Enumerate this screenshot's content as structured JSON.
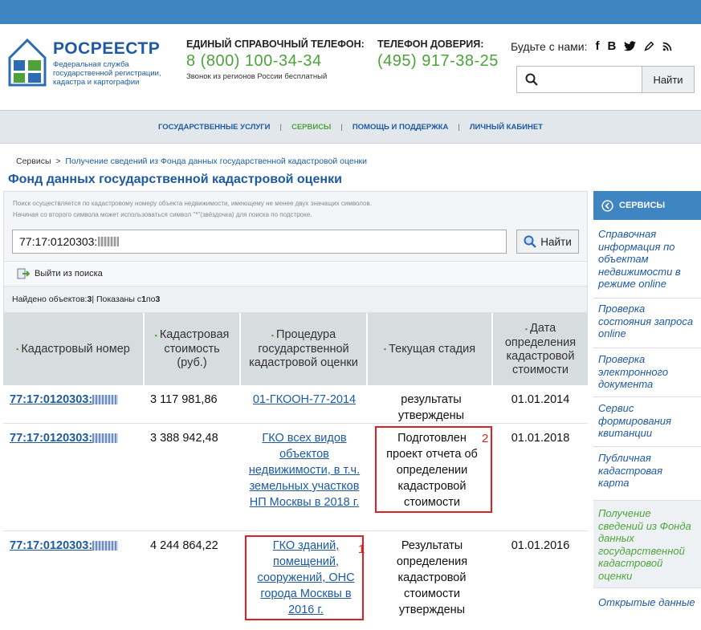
{
  "header": {
    "logo_title": "РОСРЕЕСТР",
    "logo_subtitle": "Федеральная служба государственной регистрации, кадастра и картографии",
    "phone1_label": "ЕДИНЫЙ СПРАВОЧНЫЙ ТЕЛЕФОН:",
    "phone1_number": "8 (800) 100-34-34",
    "phone1_note": "Звонок из регионов России бесплатный",
    "phone2_label": "ТЕЛЕФОН ДОВЕРИЯ:",
    "phone2_number": "(495) 917-38-25",
    "social_label": "Будьте с нами:",
    "social_icons": [
      "f",
      "B",
      "twitter-icon",
      "pen-icon",
      "rss-icon"
    ],
    "search_button": "Найти"
  },
  "nav": {
    "items": [
      "ГОСУДАРСТВЕННЫЕ УСЛУГИ",
      "СЕРВИСЫ",
      "ПОМОЩЬ И ПОДДЕРЖКА",
      "ЛИЧНЫЙ КАБИНЕТ"
    ],
    "active_index": 1
  },
  "breadcrumb": {
    "root": "Сервисы",
    "sep": ">",
    "current": "Получение сведений из Фонда данных государственной кадастровой оценки"
  },
  "page_title": "Фонд данных государственной кадастровой оценки",
  "search": {
    "hint1": "Поиск осуществляется по кадастровому номеру объекта недвижимости, имеющему не менее двух значащих символов.",
    "hint2": "Начиная со второго символа может использоваться символ \"*\"(звёздочка) для поиска по подстроке.",
    "query": "77:17:0120303:",
    "find_button": "Найти",
    "exit_label": "Выйти из поиска"
  },
  "found": {
    "prefix": "Найдено объектов: ",
    "count": "3",
    "middle": " | Показаны с ",
    "from": "1",
    "to_word": " по ",
    "to": "3"
  },
  "table": {
    "headers": [
      "Кадастровый номер",
      "Кадастровая стоимость (руб.)",
      "Процедура государственной кадастровой оценки",
      "Текущая стадия",
      "Дата определения кадастровой стоимости"
    ],
    "rows": [
      {
        "cad": "77:17:0120303:",
        "cost": "3 117 981,86",
        "proc": "01-ГКООН-77-2014",
        "stage": "результаты утверждены",
        "date": "01.01.2014"
      },
      {
        "cad": "77:17:0120303:",
        "cost": "3 388 942,48",
        "proc": "ГКО всех видов объектов недвижимости, в т.ч. земельных участков НП Москвы в 2018 г.",
        "stage": "Подготовлен проект отчета об определении кадастровой стоимости",
        "date": "01.01.2018"
      },
      {
        "cad": "77:17:0120303:",
        "cost": "4 244 864,22",
        "proc": "ГКО зданий, помещений, сооружений, ОНС города Москвы в 2016 г.",
        "stage": "Результаты определения кадастровой стоимости утверждены",
        "date": "01.01.2016"
      }
    ],
    "annotations": [
      "2",
      "1"
    ]
  },
  "sidebar": {
    "title": "СЕРВИСЫ",
    "items": [
      "Справочная информация по объектам недвижимости в режиме online",
      "Проверка состояния запроса online",
      "Проверка электронного документа",
      "Сервис формирования квитанции",
      "Публичная кадастровая карта",
      "Получение сведений из Фонда данных государственной кадастровой оценки",
      "Открытые данные"
    ],
    "active_index": 5
  },
  "colors": {
    "brand_blue": "#1d5aa3",
    "accent_green": "#4da33a",
    "annotation_red": "#e02020"
  }
}
